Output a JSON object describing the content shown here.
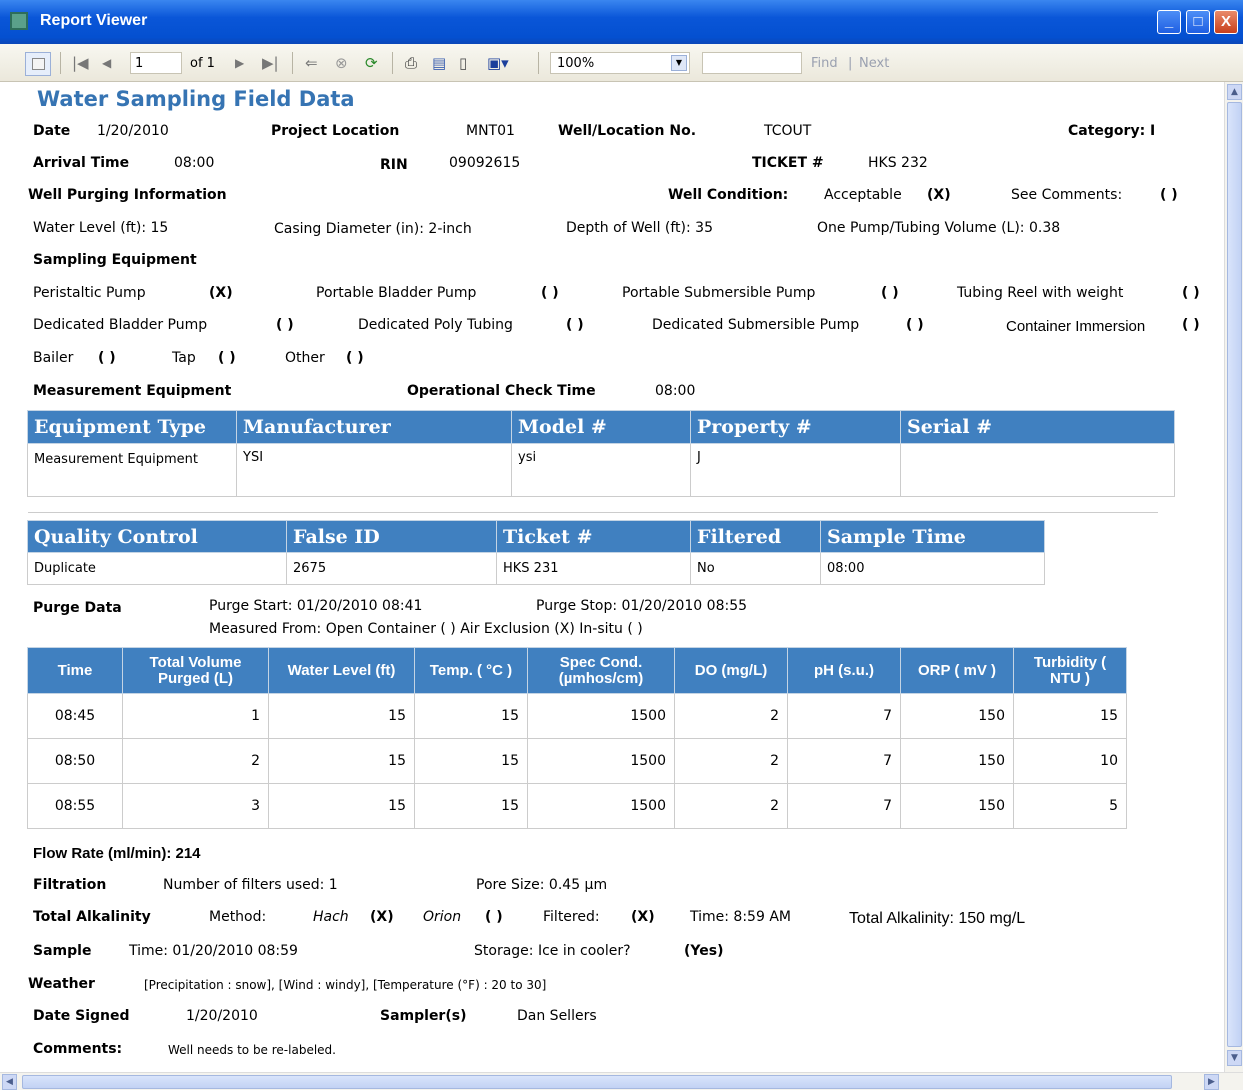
{
  "window": {
    "title": "Report Viewer",
    "buttons": {
      "minimize": "_",
      "maximize": "□",
      "close": "X"
    }
  },
  "toolbar": {
    "page_value": "1",
    "page_of": "of 1",
    "zoom": "100%",
    "find_label": "Find",
    "separator": "|",
    "next_label": "Next"
  },
  "report": {
    "title": "Water Sampling Field Data",
    "date_label": "Date",
    "date": "1/20/2010",
    "project_location_label": "Project Location",
    "project_location": "MNT01",
    "well_location_label": "Well/Location No.",
    "well_location": "TCOUT",
    "category": "Category: I",
    "arrival_time_label": "Arrival Time",
    "arrival_time": "08:00",
    "rin_label": "RIN",
    "rin": "09092615",
    "ticket_label": "TICKET #",
    "ticket": "HKS 232",
    "purging_heading": "Well Purging Information",
    "well_condition_label": "Well Condition:",
    "well_condition": "Acceptable",
    "mark_x": "(X)",
    "mark_empty": "( )",
    "see_comments": "See Comments:",
    "water_level": "Water Level (ft): 15",
    "casing_diameter": "Casing Diameter (in): 2-inch",
    "depth_of_well": "Depth of Well (ft): 35",
    "pump_volume": "One Pump/Tubing Volume (L): 0.38",
    "sampling_equipment_heading": "Sampling Equipment",
    "equip": {
      "peristaltic": "Peristaltic Pump",
      "portable_bladder": "Portable Bladder Pump",
      "portable_submersible": "Portable Submersible Pump",
      "tubing_reel": "Tubing Reel with weight",
      "dedicated_bladder": "Dedicated Bladder Pump",
      "dedicated_poly": "Dedicated Poly Tubing",
      "dedicated_submersible": "Dedicated Submersible Pump",
      "container_immersion": "Container Immersion",
      "bailer": "Bailer",
      "tap": "Tap",
      "other": "Other"
    },
    "measurement_heading": "Measurement Equipment",
    "operational_check_label": "Operational Check Time",
    "operational_check": "08:00",
    "measurement_table": {
      "headers": [
        "Equipment Type",
        "Manufacturer",
        "Model #",
        "Property #",
        "Serial #"
      ],
      "rows": [
        [
          "Measurement Equipment",
          "YSI",
          "ysi",
          "J",
          ""
        ]
      ]
    },
    "qc_table": {
      "headers": [
        "Quality Control",
        "False ID",
        "Ticket #",
        "Filtered",
        "Sample Time"
      ],
      "rows": [
        [
          "Duplicate",
          "2675",
          "HKS 231",
          "No",
          "08:00"
        ]
      ]
    },
    "purge_data_label": "Purge Data",
    "purge_start": "Purge Start: 01/20/2010 08:41",
    "purge_stop": "Purge Stop: 01/20/2010 08:55",
    "measured_from": "Measured From: Open Container ( ) Air Exclusion (X) In-situ ( )",
    "purge_table": {
      "headers": [
        "Time",
        "Total Volume Purged (L)",
        "Water Level (ft)",
        "Temp. ( °C )",
        "Spec Cond. (µmhos/cm)",
        "DO (mg/L)",
        "pH (s.u.)",
        "ORP ( mV )",
        "Turbidity ( NTU )"
      ],
      "rows": [
        [
          "08:45",
          "1",
          "15",
          "15",
          "1500",
          "2",
          "7",
          "150",
          "15"
        ],
        [
          "08:50",
          "2",
          "15",
          "15",
          "1500",
          "2",
          "7",
          "150",
          "10"
        ],
        [
          "08:55",
          "3",
          "15",
          "15",
          "1500",
          "2",
          "7",
          "150",
          "5"
        ]
      ]
    },
    "flow_rate": "Flow Rate (ml/min): 214",
    "filtration_label": "Filtration",
    "filters_used": "Number of filters used: 1",
    "pore_size": "Pore Size: 0.45 µm",
    "alkalinity_label": "Total Alkalinity",
    "method_label": "Method:",
    "hach": "Hach",
    "orion": "Orion",
    "filtered_label": "Filtered:",
    "alk_time": "Time: 8:59 AM",
    "alk_total": "Total Alkalinity: 150 mg/L",
    "sample_label": "Sample",
    "sample_time": "Time: 01/20/2010 08:59",
    "storage": "Storage: Ice in cooler?",
    "storage_value": "(Yes)",
    "weather_label": "Weather",
    "weather": "[Precipitation : snow], [Wind : windy], [Temperature (°F) : 20 to 30]",
    "date_signed_label": "Date Signed",
    "date_signed": "1/20/2010",
    "samplers_label": "Sampler(s)",
    "samplers": "Dan Sellers",
    "comments_label": "Comments:",
    "comments": "Well needs to be re-labeled."
  }
}
